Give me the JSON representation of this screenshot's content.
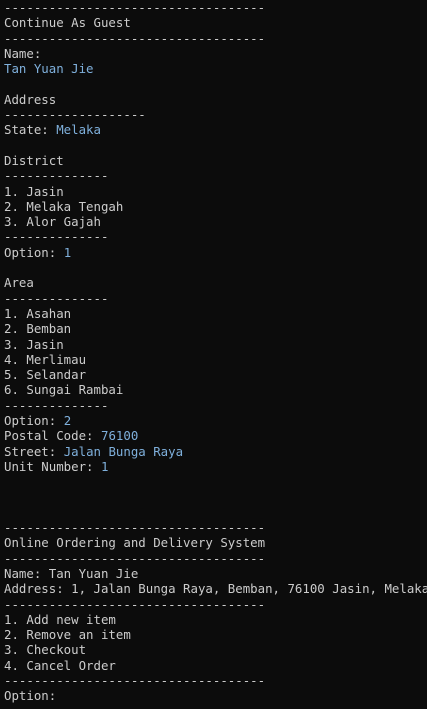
{
  "terminal": {
    "lines": [
      [
        {
          "t": "-----------------------------------"
        }
      ],
      [
        {
          "t": "Continue As Guest"
        }
      ],
      [
        {
          "t": "-----------------------------------"
        }
      ],
      [
        {
          "t": "Name:"
        }
      ],
      [
        {
          "t": "Tan Yuan Jie",
          "v": true
        }
      ],
      [
        {
          "t": ""
        }
      ],
      [
        {
          "t": "Address"
        }
      ],
      [
        {
          "t": "-------------------"
        }
      ],
      [
        {
          "t": "State: "
        },
        {
          "t": "Melaka",
          "v": true
        }
      ],
      [
        {
          "t": ""
        }
      ],
      [
        {
          "t": "District"
        }
      ],
      [
        {
          "t": "--------------"
        }
      ],
      [
        {
          "t": "1. Jasin"
        }
      ],
      [
        {
          "t": "2. Melaka Tengah"
        }
      ],
      [
        {
          "t": "3. Alor Gajah"
        }
      ],
      [
        {
          "t": "--------------"
        }
      ],
      [
        {
          "t": "Option: "
        },
        {
          "t": "1",
          "v": true
        }
      ],
      [
        {
          "t": ""
        }
      ],
      [
        {
          "t": "Area"
        }
      ],
      [
        {
          "t": "--------------"
        }
      ],
      [
        {
          "t": "1. Asahan"
        }
      ],
      [
        {
          "t": "2. Bemban"
        }
      ],
      [
        {
          "t": "3. Jasin"
        }
      ],
      [
        {
          "t": "4. Merlimau"
        }
      ],
      [
        {
          "t": "5. Selandar"
        }
      ],
      [
        {
          "t": "6. Sungai Rambai"
        }
      ],
      [
        {
          "t": "--------------"
        }
      ],
      [
        {
          "t": "Option: "
        },
        {
          "t": "2",
          "v": true
        }
      ],
      [
        {
          "t": "Postal Code: "
        },
        {
          "t": "76100",
          "v": true
        }
      ],
      [
        {
          "t": "Street: "
        },
        {
          "t": "Jalan Bunga Raya",
          "v": true
        }
      ],
      [
        {
          "t": "Unit Number: "
        },
        {
          "t": "1",
          "v": true
        }
      ],
      [
        {
          "t": ""
        }
      ],
      [
        {
          "t": ""
        }
      ],
      [
        {
          "t": ""
        }
      ],
      [
        {
          "t": "-----------------------------------"
        }
      ],
      [
        {
          "t": "Online Ordering and Delivery System"
        }
      ],
      [
        {
          "t": "-----------------------------------"
        }
      ],
      [
        {
          "t": "Name: Tan Yuan Jie"
        }
      ],
      [
        {
          "t": "Address: 1, Jalan Bunga Raya, Bemban, 76100 Jasin, Melaka"
        }
      ],
      [
        {
          "t": "-----------------------------------"
        }
      ],
      [
        {
          "t": "1. Add new item"
        }
      ],
      [
        {
          "t": "2. Remove an item"
        }
      ],
      [
        {
          "t": "3. Checkout"
        }
      ],
      [
        {
          "t": "4. Cancel Order"
        }
      ],
      [
        {
          "t": "-----------------------------------"
        }
      ],
      [
        {
          "t": "Option:"
        }
      ]
    ]
  },
  "colors": {
    "background": "#0c0c0c",
    "text": "#cccccc",
    "input_value": "#7fb0dc"
  }
}
